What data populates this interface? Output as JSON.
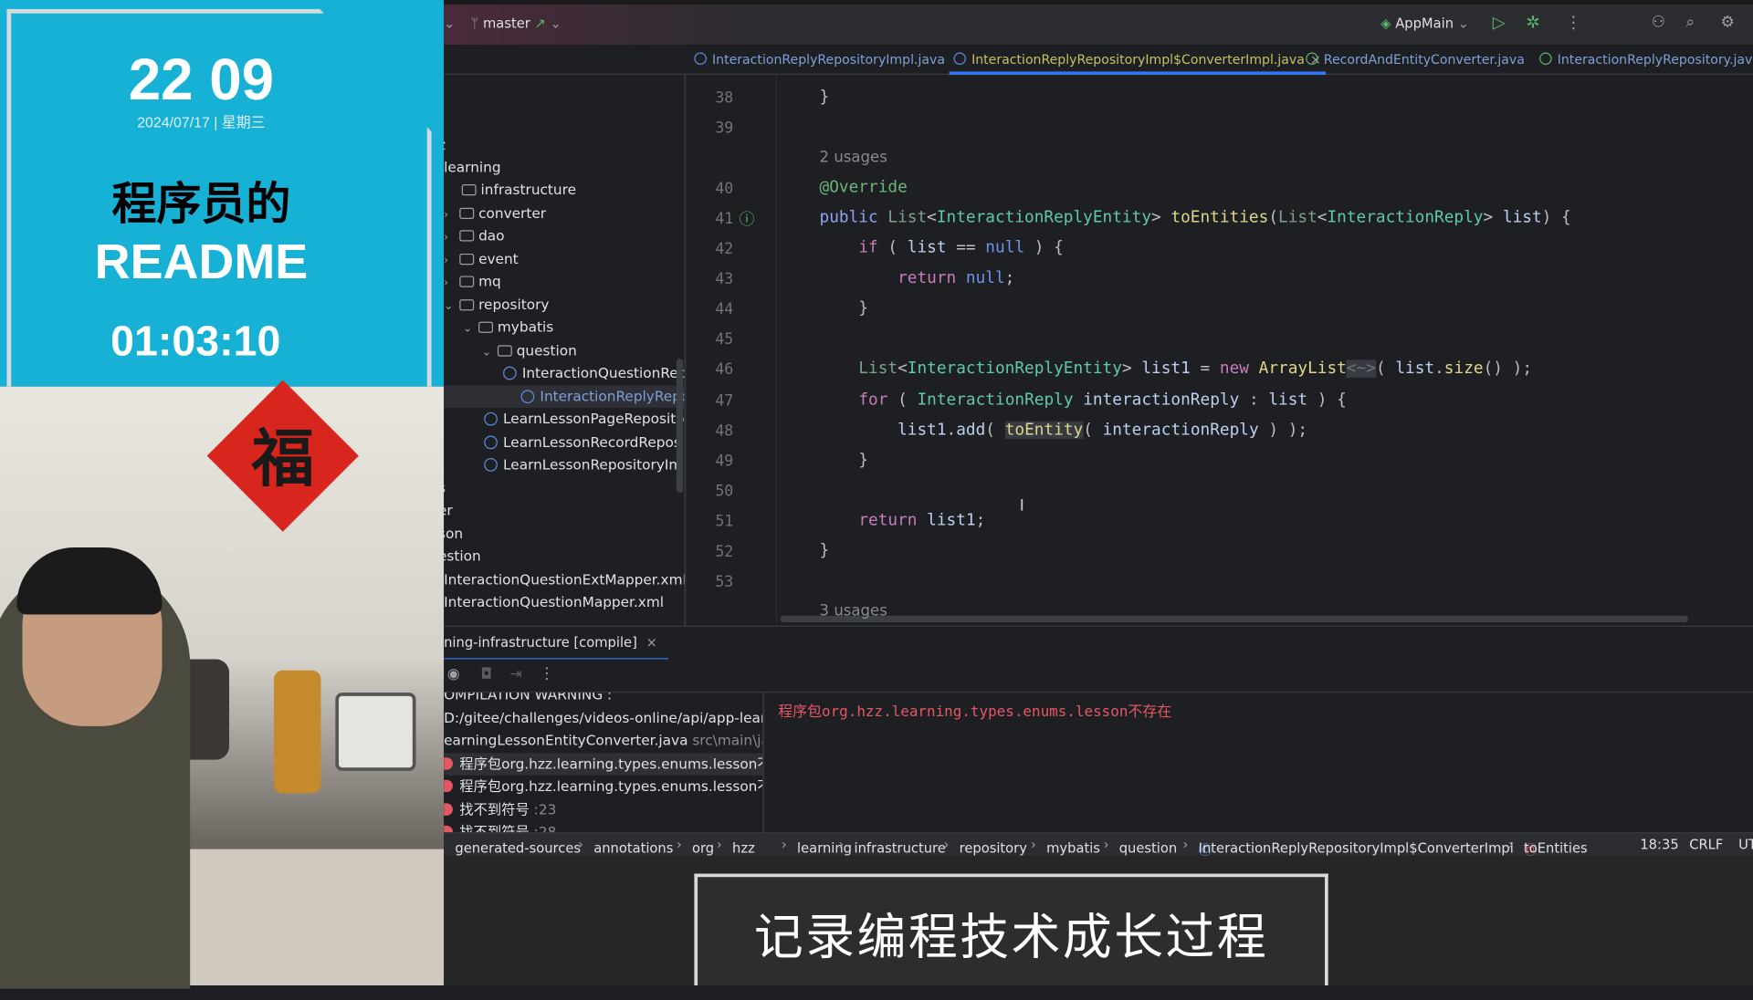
{
  "overlay": {
    "clock": "22 09",
    "date": "2024/07/17 | 星期三",
    "title_cn": "程序员的",
    "title_en": "README",
    "timer": "01:03:10",
    "fu_char": "福"
  },
  "toolbar": {
    "branch": "master",
    "run_config": "AppMain"
  },
  "tabs": [
    {
      "label": "InteractionReplyRepositoryImpl.java",
      "kind": "class",
      "active": false
    },
    {
      "label": "InteractionReplyRepositoryImpl$ConverterImpl.java",
      "kind": "class",
      "active": true
    },
    {
      "label": "RecordAndEntityConverter.java",
      "kind": "interface",
      "active": false
    },
    {
      "label": "InteractionReplyRepository.java",
      "kind": "interface",
      "active": false
    }
  ],
  "tree": [
    {
      "label": "z"
    },
    {
      "label": "learning"
    },
    {
      "label": "infrastructure"
    },
    {
      "label": "converter"
    },
    {
      "label": "dao"
    },
    {
      "label": "event"
    },
    {
      "label": "mq"
    },
    {
      "label": "repository"
    },
    {
      "label": "mybatis"
    },
    {
      "label": "question"
    },
    {
      "label": "InteractionQuestionRep"
    },
    {
      "label": "InteractionReplyReposi"
    },
    {
      "label": "LearnLessonPageReposito"
    },
    {
      "label": "LearnLessonRecordRepos"
    },
    {
      "label": "LearnLessonRepositoryIm"
    },
    {
      "label": "s"
    },
    {
      "label": "er"
    },
    {
      "label": "son"
    },
    {
      "label": "estion"
    },
    {
      "label": "InteractionQuestionExtMapper.xml"
    },
    {
      "label": "InteractionQuestionMapper.xml"
    }
  ],
  "editor": {
    "lines": [
      {
        "num": "38",
        "tokens": [
          [
            "}",
            "p"
          ]
        ]
      },
      {
        "num": "39",
        "tokens": []
      },
      {
        "usage": "2 usages"
      },
      {
        "num": "40",
        "tokens": [
          [
            "@Override",
            "a"
          ]
        ]
      },
      {
        "num": "41",
        "tokens": [
          [
            "public ",
            "kp"
          ],
          [
            "List",
            "g"
          ],
          [
            "<",
            "p"
          ],
          [
            "InteractionReplyEntity",
            "t"
          ],
          [
            "> ",
            "p"
          ],
          [
            "toEntities",
            "m"
          ],
          [
            "(",
            "p"
          ],
          [
            "List",
            "g"
          ],
          [
            "<",
            "p"
          ],
          [
            "InteractionReply",
            "t"
          ],
          [
            "> ",
            "p"
          ],
          [
            "list",
            ""
          ],
          [
            ") {",
            "p"
          ]
        ]
      },
      {
        "num": "42",
        "tokens": [
          [
            "    ",
            ""
          ],
          [
            "if",
            "k"
          ],
          [
            " ( ",
            "p"
          ],
          [
            "list",
            ""
          ],
          [
            " == ",
            "p"
          ],
          [
            "null",
            "n"
          ],
          [
            " ) {",
            "p"
          ]
        ]
      },
      {
        "num": "43",
        "tokens": [
          [
            "        ",
            ""
          ],
          [
            "return",
            "k"
          ],
          [
            " ",
            ""
          ],
          [
            "null",
            "n"
          ],
          [
            ";",
            "p"
          ]
        ]
      },
      {
        "num": "44",
        "tokens": [
          [
            "    }",
            "p"
          ]
        ]
      },
      {
        "num": "45",
        "tokens": []
      },
      {
        "num": "46",
        "tokens": [
          [
            "    ",
            ""
          ],
          [
            "List",
            "g"
          ],
          [
            "<",
            "p"
          ],
          [
            "InteractionReplyEntity",
            "t"
          ],
          [
            "> ",
            "p"
          ],
          [
            "list1",
            ""
          ],
          [
            " = ",
            "p"
          ],
          [
            "new",
            "k"
          ],
          [
            " ",
            ""
          ],
          [
            "ArrayList",
            "m"
          ],
          [
            "<~>",
            "dim hl"
          ],
          [
            "( ",
            "p"
          ],
          [
            "list",
            ""
          ],
          [
            ".",
            "p"
          ],
          [
            "size",
            "m"
          ],
          [
            "() );",
            "p"
          ]
        ]
      },
      {
        "num": "47",
        "tokens": [
          [
            "    ",
            ""
          ],
          [
            "for",
            "k"
          ],
          [
            " ( ",
            "p"
          ],
          [
            "InteractionReply",
            "t"
          ],
          [
            " ",
            ""
          ],
          [
            "interactionReply",
            ""
          ],
          [
            " : ",
            "p"
          ],
          [
            "list",
            ""
          ],
          [
            " ) {",
            "p"
          ]
        ]
      },
      {
        "num": "48",
        "tokens": [
          [
            "        ",
            ""
          ],
          [
            "list1",
            ""
          ],
          [
            ".",
            "p"
          ],
          [
            "add",
            ""
          ],
          [
            "( ",
            "p"
          ],
          [
            "toEntity",
            "m hl"
          ],
          [
            "( ",
            "p"
          ],
          [
            "interactionReply",
            ""
          ],
          [
            " ) );",
            "p"
          ]
        ]
      },
      {
        "num": "49",
        "tokens": [
          [
            "    }",
            "p"
          ]
        ]
      },
      {
        "num": "50",
        "tokens": []
      },
      {
        "num": "51",
        "tokens": [
          [
            "    ",
            ""
          ],
          [
            "return",
            "k"
          ],
          [
            " ",
            ""
          ],
          [
            "list1",
            ""
          ],
          [
            ";",
            "p"
          ]
        ]
      },
      {
        "num": "52",
        "tokens": [
          [
            "}",
            "p"
          ]
        ]
      },
      {
        "num": "53",
        "tokens": []
      },
      {
        "usage": "3 usages"
      }
    ]
  },
  "build": {
    "tab_label": "ning-infrastructure [compile]",
    "items": [
      {
        "text": "OMPILATION WARNING :",
        "type": "plain"
      },
      {
        "text": "D:/gitee/challenges/videos-online/api/app-learning",
        "type": "plain"
      },
      {
        "text": "earningLessonEntityConverter.java",
        "suffix": " src\\main\\java\\",
        "type": "file"
      },
      {
        "text": "程序包org.hzz.learning.types.enums.lesson不存在",
        "type": "error"
      },
      {
        "text": "程序包org.hzz.learning.types.enums.lesson不存在",
        "type": "error"
      },
      {
        "text": "找不到符号",
        "suffix": " :23",
        "type": "error"
      },
      {
        "text": "找不到符号",
        "suffix": " :28",
        "type": "error"
      }
    ],
    "detail": "程序包org.hzz.learning.types.enums.lesson不存在",
    "error_color": "#e55765"
  },
  "status": {
    "breadcrumb": [
      "generated-sources",
      "annotations",
      "org",
      "hzz",
      "learning",
      "infrastructure",
      "repository",
      "mybatis",
      "question",
      "InteractionReplyRepositoryImpl$ConverterImpl",
      "toEntities"
    ],
    "position": "18:35",
    "line_sep": "CRLF",
    "encoding": "UT"
  },
  "caption": "记录编程技术成长过程",
  "colors": {
    "card_bg": "#17b1d6",
    "accent": "#3574f0",
    "active_tab": "#c4c265"
  }
}
